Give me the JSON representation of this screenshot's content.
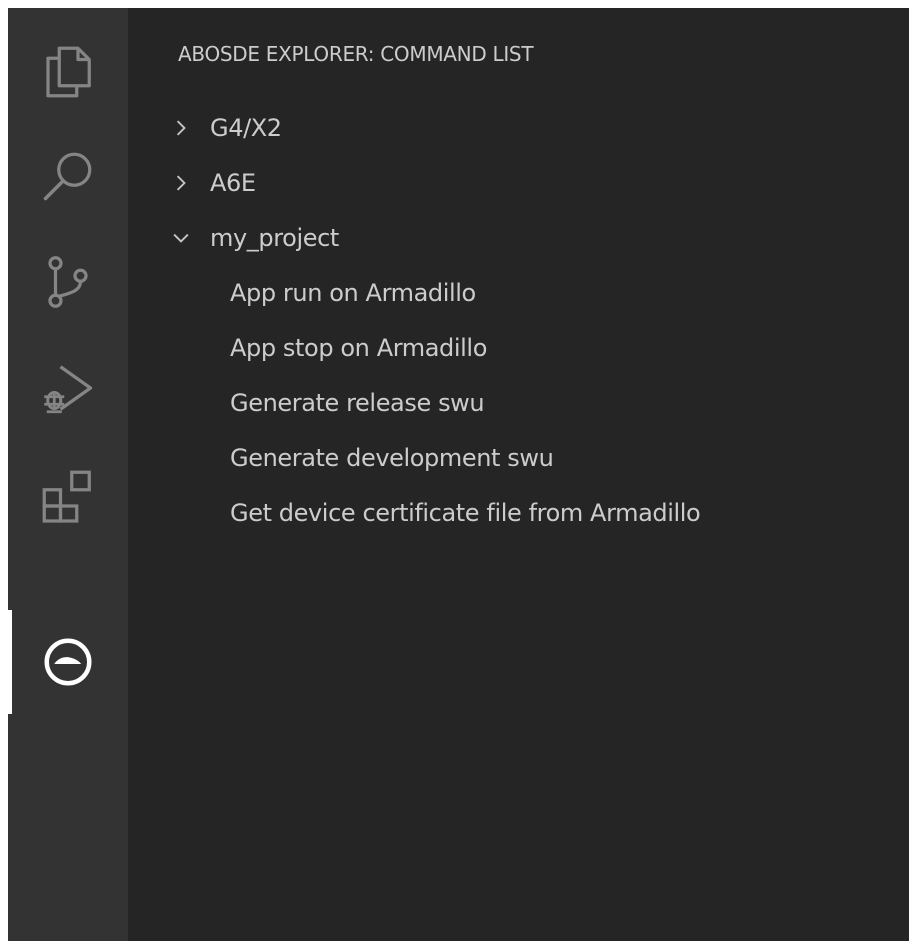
{
  "activity_bar": {
    "items": [
      {
        "icon": "explorer-files-icon"
      },
      {
        "icon": "search-icon"
      },
      {
        "icon": "source-control-icon"
      },
      {
        "icon": "run-and-debug-icon"
      },
      {
        "icon": "extensions-icon"
      },
      {
        "icon": "abosde-extension-icon",
        "active": true
      }
    ]
  },
  "sidebar": {
    "title": "ABOSDE EXPLORER: COMMAND LIST",
    "tree": {
      "nodes": [
        {
          "label": "G4/X2",
          "expanded": false
        },
        {
          "label": "A6E",
          "expanded": false
        },
        {
          "label": "my_project",
          "expanded": true,
          "children": [
            "App run on Armadillo",
            "App stop on Armadillo",
            "Generate release swu",
            "Generate development swu",
            "Get device certificate file from Armadillo"
          ]
        }
      ]
    }
  },
  "colors": {
    "activity_bar_bg": "#333333",
    "sidebar_bg": "#252526",
    "icon_inactive": "#858585",
    "icon_active": "#ffffff",
    "text": "#cccccc"
  }
}
